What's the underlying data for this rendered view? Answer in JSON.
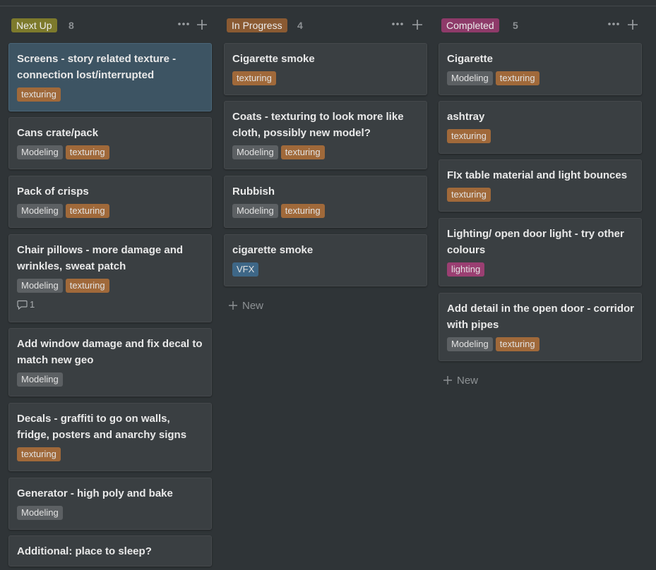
{
  "columns": [
    {
      "name": "Next Up",
      "count": "8",
      "badge_color": "#7d7a2c",
      "cards": [
        {
          "title": "Screens - story related texture - connection lost/interrupted",
          "tags": [
            {
              "label": "texturing",
              "kind": "texturing"
            }
          ],
          "selected": true
        },
        {
          "title": "Cans crate/pack",
          "tags": [
            {
              "label": "Modeling",
              "kind": "modeling"
            },
            {
              "label": "texturing",
              "kind": "texturing"
            }
          ]
        },
        {
          "title": "Pack of crisps",
          "tags": [
            {
              "label": "Modeling",
              "kind": "modeling"
            },
            {
              "label": "texturing",
              "kind": "texturing"
            }
          ]
        },
        {
          "title": "Chair pillows - more damage and wrinkles, sweat patch",
          "tags": [
            {
              "label": "Modeling",
              "kind": "modeling"
            },
            {
              "label": "texturing",
              "kind": "texturing"
            }
          ],
          "comments": "1"
        },
        {
          "title": "Add window damage and fix decal to match new geo",
          "tags": [
            {
              "label": "Modeling",
              "kind": "modeling"
            }
          ]
        },
        {
          "title": "Decals - graffiti to go on walls, fridge, posters and anarchy signs",
          "tags": [
            {
              "label": "texturing",
              "kind": "texturing"
            }
          ]
        },
        {
          "title": "Generator - high poly and bake",
          "tags": [
            {
              "label": "Modeling",
              "kind": "modeling"
            }
          ]
        },
        {
          "title": "Additional: place to sleep?",
          "tags": []
        }
      ]
    },
    {
      "name": "In Progress",
      "count": "4",
      "badge_color": "#8a5a32",
      "new_label": "New",
      "cards": [
        {
          "title": "Cigarette smoke",
          "tags": [
            {
              "label": "texturing",
              "kind": "texturing"
            }
          ]
        },
        {
          "title": "Coats - texturing to look more like cloth, possibly new model?",
          "tags": [
            {
              "label": "Modeling",
              "kind": "modeling"
            },
            {
              "label": "texturing",
              "kind": "texturing"
            }
          ]
        },
        {
          "title": "Rubbish",
          "tags": [
            {
              "label": "Modeling",
              "kind": "modeling"
            },
            {
              "label": "texturing",
              "kind": "texturing"
            }
          ]
        },
        {
          "title": "cigarette smoke",
          "tags": [
            {
              "label": "VFX",
              "kind": "vfx"
            }
          ]
        }
      ]
    },
    {
      "name": "Completed",
      "count": "5",
      "badge_color": "#8e3a69",
      "new_label": "New",
      "cards": [
        {
          "title": "Cigarette",
          "tags": [
            {
              "label": "Modeling",
              "kind": "modeling"
            },
            {
              "label": "texturing",
              "kind": "texturing"
            }
          ]
        },
        {
          "title": "ashtray",
          "tags": [
            {
              "label": "texturing",
              "kind": "texturing"
            }
          ]
        },
        {
          "title": "FIx table material and light bounces",
          "tags": [
            {
              "label": "texturing",
              "kind": "texturing"
            }
          ]
        },
        {
          "title": "Lighting/ open door light - try other colours",
          "tags": [
            {
              "label": "lighting",
              "kind": "lighting"
            }
          ]
        },
        {
          "title": "Add detail in the open door - corridor with pipes",
          "tags": [
            {
              "label": "Modeling",
              "kind": "modeling"
            },
            {
              "label": "texturing",
              "kind": "texturing"
            }
          ]
        }
      ]
    }
  ],
  "icons": {
    "more": "more-dots-icon",
    "add": "plus-icon",
    "comment": "comment-icon"
  }
}
